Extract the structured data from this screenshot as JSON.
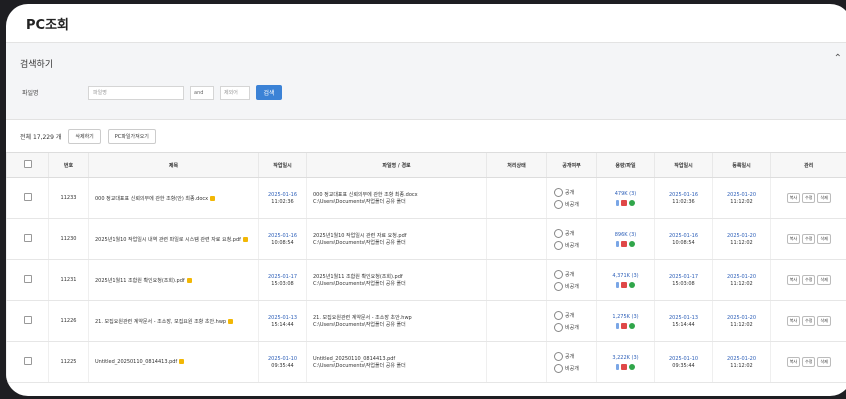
{
  "window": {
    "title": "PC조회"
  },
  "search": {
    "title": "검색하기",
    "collapse_icon": "chevron-icon",
    "field_label": "파일명",
    "placeholder": "파일명",
    "select_value": "and",
    "placeholder2": "제외어",
    "button": "검색"
  },
  "toolbar": {
    "count": "전체 17,229 개",
    "btn_delete": "삭제하기",
    "btn_pc": "PC파일가져오기"
  },
  "table": {
    "headers": [
      "",
      "번호",
      "제목",
      "작업일시",
      "파일명 / 경로",
      "처리상태",
      "공개여부",
      "용량/파일",
      "작업일시",
      "등록일시",
      "관리"
    ],
    "rows": [
      {
        "no": "11233",
        "title": "000 정교대표표 신뢰의무에 관한 조항(안) 최종.docx",
        "date1": "2025-01-16",
        "time1": "11:02:36",
        "path1": "000 정교대표표 신뢰의무에 관한 조항 최종.docx",
        "path2": "C:\\Users\\Documents\\작업폴더 공유 폴더",
        "r1": "공개",
        "r2": "비공개",
        "size": "479K (3)",
        "d3": "2025-01-16",
        "t3": "11:02:36",
        "d4": "2025-01-20",
        "t4": "11:12:02",
        "acts": [
          "복사",
          "수정",
          "삭제"
        ]
      },
      {
        "no": "11230",
        "title": "2025년1월10 작업일시 내역 관련 파일로 시스템 관련 자료 요청.pdf",
        "date1": "2025-01-16",
        "time1": "10:08:54",
        "path1": "2025년1월10 작업일시 관련 자료 요청.pdf",
        "path2": "C:\\Users\\Documents\\작업폴더 공유 폴더",
        "r1": "공개",
        "r2": "비공개",
        "size": "896K (3)",
        "d3": "2025-01-16",
        "t3": "10:08:54",
        "d4": "2025-01-20",
        "t4": "11:12:02",
        "acts": [
          "복사",
          "수정",
          "삭제"
        ]
      },
      {
        "no": "11231",
        "title": "2025년1월11 조합원 확인요청(조회).pdf",
        "date1": "2025-01-17",
        "time1": "15:03:08",
        "path1": "2025년1월11 조합원 확인요청(조회).pdf",
        "path2": "C:\\Users\\Documents\\작업폴더 공유 폴더",
        "r1": "공개",
        "r2": "비공개",
        "size": "4,371K (3)",
        "d3": "2025-01-17",
        "t3": "15:03:08",
        "d4": "2025-01-20",
        "t4": "11:12:02",
        "acts": [
          "복사",
          "수정",
          "삭제"
        ]
      },
      {
        "no": "11226",
        "title": "21. 모집요원관련 계약문서 - 조소장, 모집요원 조항 초안.hwp",
        "date1": "2025-01-13",
        "time1": "15:14:44",
        "path1": "21. 모집요원관련 계약문서 - 조소장 초안.hwp",
        "path2": "C:\\Users\\Documents\\작업폴더 공유 폴더",
        "r1": "공개",
        "r2": "비공개",
        "size": "1,275K (3)",
        "d3": "2025-01-13",
        "t3": "15:14:44",
        "d4": "2025-01-20",
        "t4": "11:12:02",
        "acts": [
          "복사",
          "수정",
          "삭제"
        ]
      },
      {
        "no": "11225",
        "title": "Untitled_20250110_0814413.pdf",
        "date1": "2025-01-10",
        "time1": "09:35:44",
        "path1": "Untitled_20250110_0814413.pdf",
        "path2": "C:\\Users\\Documents\\작업폴더 공유 폴더",
        "r1": "공개",
        "r2": "비공개",
        "size": "3,222K (3)",
        "d3": "2025-01-10",
        "t3": "09:35:44",
        "d4": "2025-01-20",
        "t4": "11:12:02",
        "acts": [
          "복사",
          "수정",
          "삭제"
        ]
      }
    ]
  }
}
